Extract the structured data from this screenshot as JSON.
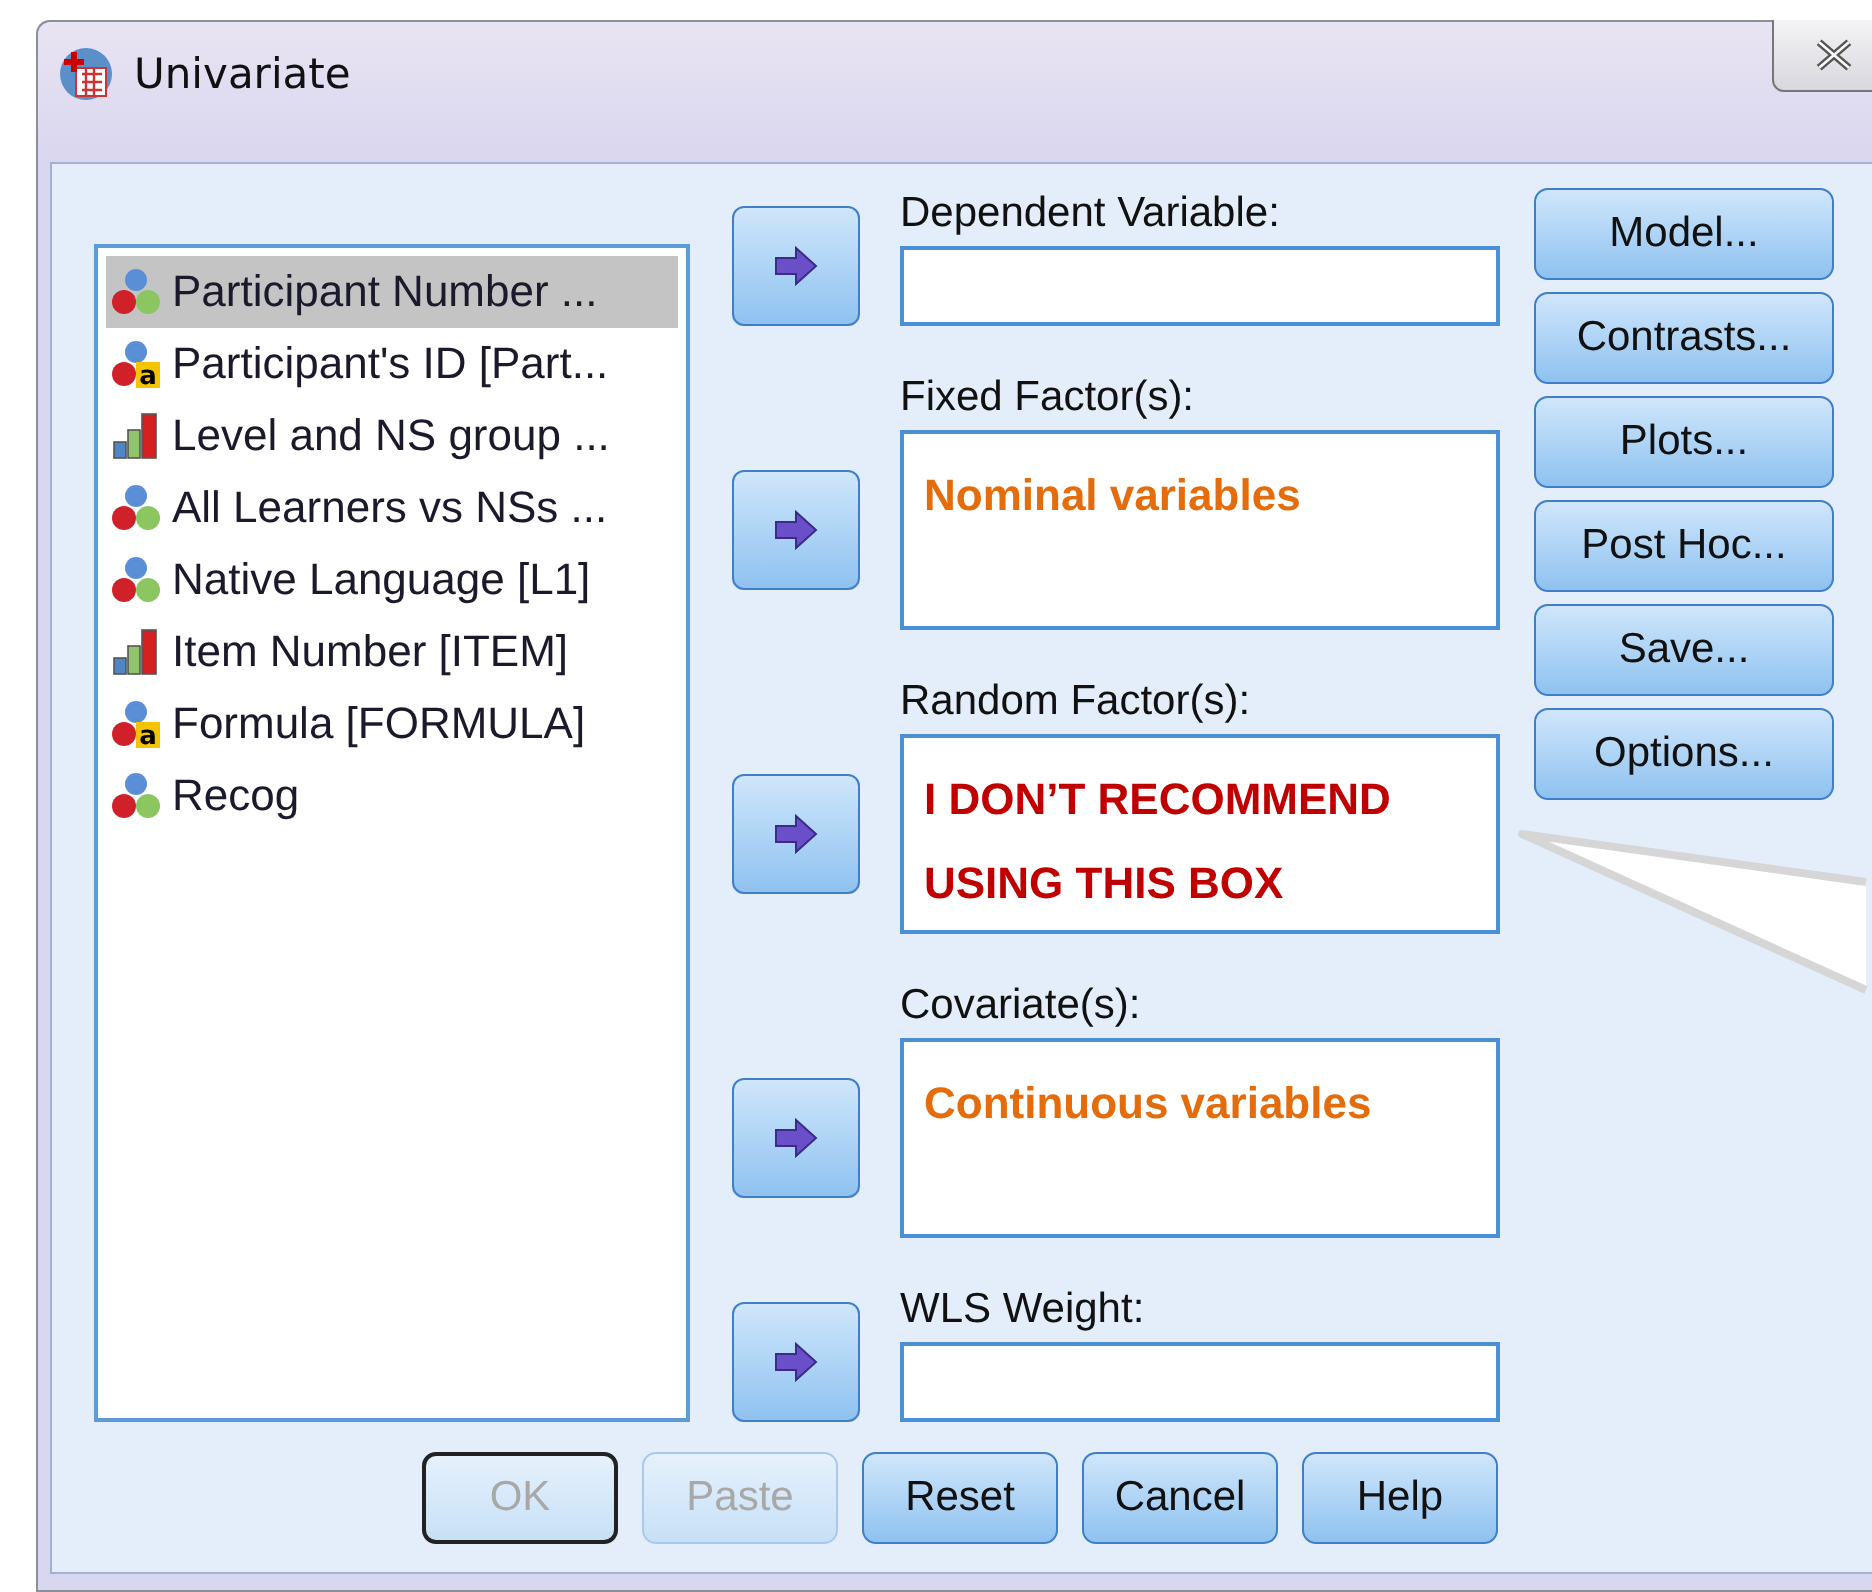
{
  "window": {
    "title": "Univariate"
  },
  "variables": [
    {
      "label": "Participant Number ...",
      "kind": "nominal",
      "selected": true
    },
    {
      "label": "Participant's ID [Part...",
      "kind": "string",
      "badge": "a",
      "selected": false
    },
    {
      "label": "Level and NS group ...",
      "kind": "ordinal",
      "selected": false
    },
    {
      "label": "All Learners vs NSs ...",
      "kind": "nominal",
      "selected": false
    },
    {
      "label": "Native Language [L1]",
      "kind": "nominal",
      "selected": false
    },
    {
      "label": "Item Number [ITEM]",
      "kind": "ordinal",
      "selected": false
    },
    {
      "label": "Formula [FORMULA]",
      "kind": "string",
      "badge": "a",
      "selected": false
    },
    {
      "label": "Recog",
      "kind": "nominal",
      "selected": false
    }
  ],
  "targets": [
    {
      "label": "Dependent Variable:",
      "kind": "single"
    },
    {
      "label": "Fixed Factor(s):",
      "kind": "list",
      "note": "Nominal variables",
      "color": "#e46c0a"
    },
    {
      "label": "Random Factor(s):",
      "kind": "list",
      "note": "I DON’T RECOMMEND USING THIS BOX",
      "color": "#c00000"
    },
    {
      "label": "Covariate(s):",
      "kind": "list",
      "note": "Continuous  variables",
      "color": "#e46c0a"
    },
    {
      "label": "WLS Weight:",
      "kind": "single"
    }
  ],
  "side_buttons": [
    "Model...",
    "Contrasts...",
    "Plots...",
    "Post Hoc...",
    "Save...",
    "Options..."
  ],
  "bottom_buttons": [
    {
      "label": "OK",
      "disabled": true,
      "default": true
    },
    {
      "label": "Paste",
      "disabled": true,
      "default": false
    },
    {
      "label": "Reset",
      "disabled": false,
      "default": false
    },
    {
      "label": "Cancel",
      "disabled": false,
      "default": false
    },
    {
      "label": "Help",
      "disabled": false,
      "default": false
    }
  ],
  "callout": {
    "kind": "pointer"
  }
}
